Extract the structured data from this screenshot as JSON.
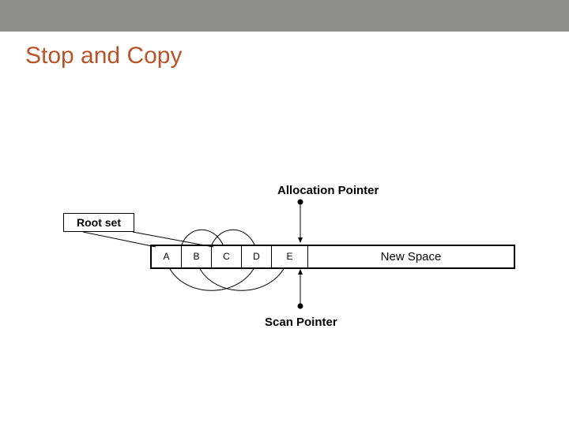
{
  "title": "Stop and Copy",
  "alloc_label": "Allocation Pointer",
  "rootset_label": "Root set",
  "cells": {
    "a": "A",
    "b": "B",
    "c": "C",
    "d": "D",
    "e": "E"
  },
  "newspace_label": "New Space",
  "scan_label": "Scan Pointer"
}
